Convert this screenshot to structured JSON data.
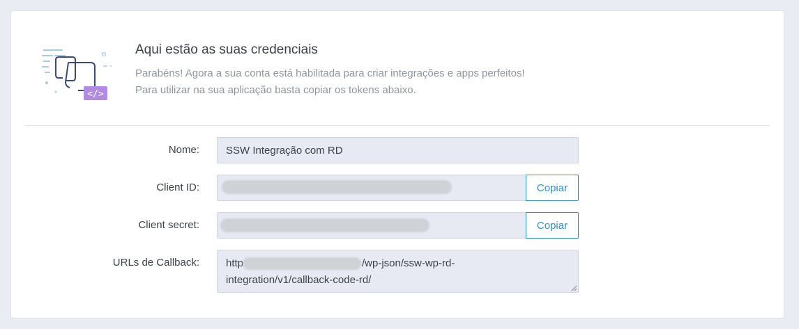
{
  "header": {
    "title": "Aqui estão as suas credenciais",
    "description_line1": "Parabéns! Agora a sua conta está habilitada para criar integrações e apps perfeitos!",
    "description_line2": "Para utilizar na sua aplicação basta copiar os tokens abaixo."
  },
  "fields": {
    "name": {
      "label": "Nome:",
      "value": "SSW Integração com RD"
    },
    "client_id": {
      "label": "Client ID:",
      "copy_label": "Copiar"
    },
    "client_secret": {
      "label": "Client secret:",
      "copy_label": "Copiar"
    },
    "callback": {
      "label": "URLs de Callback:",
      "value_prefix": "http",
      "value_line1_suffix": "/wp-json/ssw-wp-rd-",
      "value_line2": "integration/v1/callback-code-rd/"
    }
  },
  "colors": {
    "accent": "#2e8fd0",
    "illustration_purple": "#b18be0",
    "illustration_navy": "#3a4a7a"
  },
  "icons": {
    "illustration": "code-window-illustration"
  }
}
